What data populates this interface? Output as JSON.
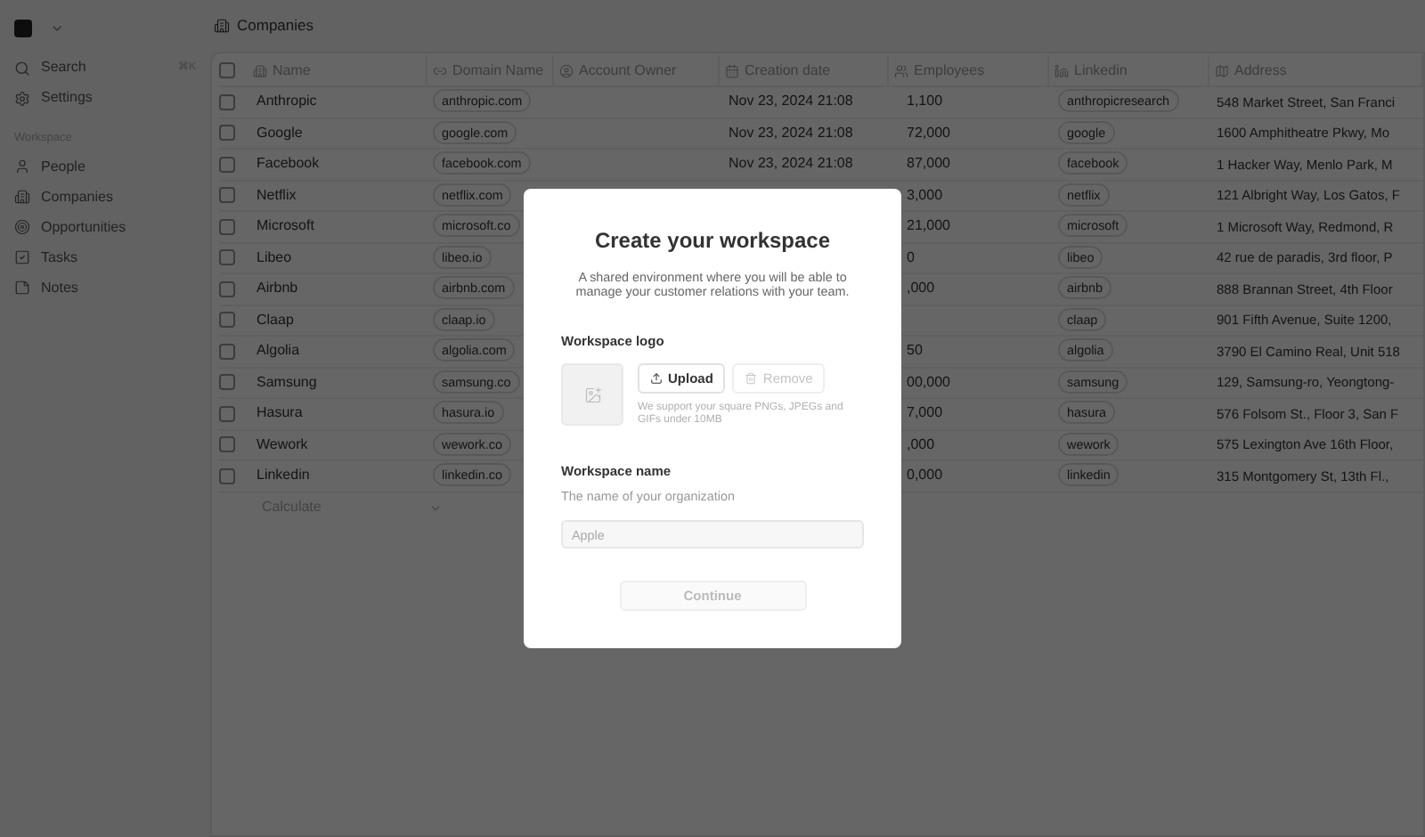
{
  "sidebar": {
    "shortcut": "⌘K",
    "top_items": [
      {
        "label": "Search",
        "selected": false
      },
      {
        "label": "Settings",
        "selected": false
      }
    ],
    "section": "Workspace",
    "items": [
      {
        "label": "People",
        "selected": false
      },
      {
        "label": "Companies",
        "selected": false
      },
      {
        "label": "Opportunities",
        "selected": false
      },
      {
        "label": "Tasks",
        "selected": false
      },
      {
        "label": "Notes",
        "selected": false
      }
    ]
  },
  "header": {
    "title": "Companies"
  },
  "table": {
    "all_checked": false,
    "columns": [
      "Name",
      "Domain Name",
      "Account Owner",
      "Creation date",
      "Employees",
      "Linkedin",
      "Address"
    ],
    "rows": [
      {
        "checked": false,
        "name": "Anthropic",
        "domain": "anthropic.com",
        "created": "Nov 23, 2024 21:08",
        "employees": "1,100",
        "linkedin": "anthropicresearch",
        "address": "548 Market Street, San Franci"
      },
      {
        "checked": false,
        "name": "Google",
        "domain": "google.com",
        "created": "Nov 23, 2024 21:08",
        "employees": "72,000",
        "linkedin": "google",
        "address": "1600 Amphitheatre Pkwy, Mo"
      },
      {
        "checked": false,
        "name": "Facebook",
        "domain": "facebook.com",
        "created": "Nov 23, 2024 21:08",
        "employees": "87,000",
        "linkedin": "facebook",
        "address": "1 Hacker Way, Menlo Park, M"
      },
      {
        "checked": false,
        "name": "Netflix",
        "domain": "netflix.com",
        "employees": "3,000",
        "linkedin": "netflix",
        "address": "121 Albright Way, Los Gatos, F"
      },
      {
        "checked": false,
        "name": "Microsoft",
        "domain": "microsoft.co",
        "employees": "21,000",
        "linkedin": "microsoft",
        "address": "1 Microsoft Way, Redmond, R"
      },
      {
        "checked": false,
        "name": "Libeo",
        "domain": "libeo.io",
        "employees": "0",
        "linkedin": "libeo",
        "address": "42 rue de paradis, 3rd floor, P"
      },
      {
        "checked": false,
        "name": "Airbnb",
        "domain": "airbnb.com",
        "employees": ",000",
        "linkedin": "airbnb",
        "address": "888 Brannan Street, 4th Floor"
      },
      {
        "checked": false,
        "name": "Claap",
        "domain": "claap.io",
        "linkedin": "claap",
        "address": "901 Fifth Avenue, Suite 1200,"
      },
      {
        "checked": false,
        "name": "Algolia",
        "domain": "algolia.com",
        "employees": "50",
        "linkedin": "algolia",
        "address": "3790 El Camino Real, Unit 518"
      },
      {
        "checked": false,
        "name": "Samsung",
        "domain": "samsung.co",
        "employees": "00,000",
        "linkedin": "samsung",
        "address": "129, Samsung-ro, Yeongtong-"
      },
      {
        "checked": false,
        "name": "Hasura",
        "domain": "hasura.io",
        "employees": "7,000",
        "linkedin": "hasura",
        "address": "576 Folsom St., Floor 3, San F"
      },
      {
        "checked": false,
        "name": "Wework",
        "domain": "wework.co",
        "employees": ",000",
        "linkedin": "wework",
        "address": "575 Lexington Ave 16th Floor,"
      },
      {
        "checked": false,
        "name": "Linkedin",
        "domain": "linkedin.co",
        "employees": "0,000",
        "linkedin": "linkedin",
        "address": "315 Montgomery St, 13th Fl.,"
      }
    ],
    "footer": "Calculate"
  },
  "dialog": {
    "title": "Create your workspace",
    "description": "A shared environment where you will be able to manage your customer relations with your team.",
    "logo_label": "Workspace logo",
    "upload": {
      "label": "Upload",
      "disabled": false
    },
    "remove": {
      "label": "Remove",
      "disabled": true
    },
    "logo_hint": "We support your square PNGs, JPEGs and GIFs under 10MB",
    "name_label": "Workspace name",
    "name_hint": "The name of your organization",
    "name_placeholder": "Apple",
    "continue": {
      "label": "Continue",
      "disabled": true
    }
  }
}
